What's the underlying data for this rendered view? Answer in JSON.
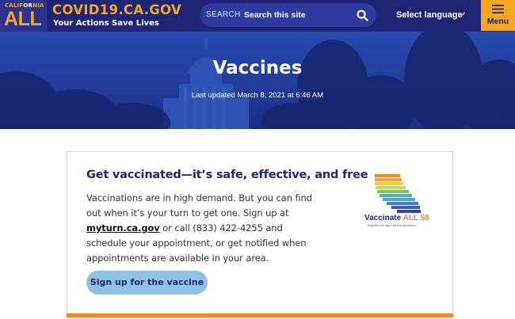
{
  "header": {
    "logo_top_pre": "CALIF",
    "logo_top_or": "OR",
    "logo_top_post": "NIA",
    "logo_main": "ALL",
    "site_title": "COVID19.CA.GOV",
    "tagline": "Your Actions Save Lives",
    "search": {
      "label": "SEARCH",
      "placeholder": "Search this site",
      "icon": "search-icon"
    },
    "language": {
      "label": "Select language",
      "icon": "chevron-down-icon"
    },
    "menu": {
      "label": "Menu",
      "icon": "hamburger-icon"
    }
  },
  "hero": {
    "title": "Vaccines",
    "updated": "Last updated March 8, 2021 at 6:46 AM"
  },
  "card": {
    "heading": "Get vaccinated—it’s safe, effective, and free",
    "body_before": "Vaccinations are in high demand. But you can find out when it’s your turn to get one. Sign up at ",
    "link": "myturn.ca.gov",
    "body_after": " or call (833) 422-4255 and schedule your appointment, or get notified when appointments are available in your area.",
    "cta": "Sign up for the vaccine",
    "logo": {
      "text_pre": "Vaccinate ",
      "text_highlight": "ALL 58",
      "tagline": "Together we can end the pandemic."
    }
  },
  "colors": {
    "header_bg": "#1f2574",
    "accent_orange": "#f5a623",
    "hero_blue": "#1e3c9e",
    "button_light_blue": "#8ec1e4",
    "card_bar_orange": "#f5851f"
  }
}
